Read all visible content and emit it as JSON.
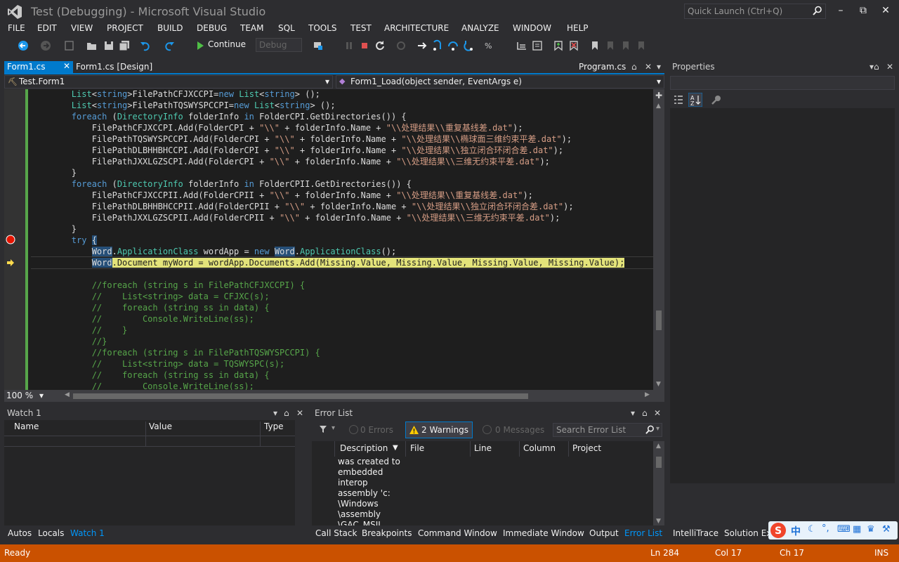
{
  "window": {
    "title": "Test (Debugging) - Microsoft Visual Studio",
    "quick_launch_placeholder": "Quick Launch (Ctrl+Q)"
  },
  "menu": [
    "FILE",
    "EDIT",
    "VIEW",
    "PROJECT",
    "BUILD",
    "DEBUG",
    "TEAM",
    "SQL",
    "TOOLS",
    "TEST",
    "ARCHITECTURE",
    "ANALYZE",
    "WINDOW",
    "HELP"
  ],
  "toolbar": {
    "continue_label": "Continue",
    "config_value": "Debug"
  },
  "doc_tabs": {
    "active": "Form1.cs",
    "design": "Form1.cs [Design]",
    "program": "Program.cs"
  },
  "nav": {
    "class_scope": "Test.Form1",
    "member_scope": "Form1_Load(object sender, EventArgs e)"
  },
  "editor": {
    "zoom": "100 %"
  },
  "code_lines": [
    "        List<string>FilePathCFJXCCPI=new List<string> ();",
    "        List<string>FilePathTQSWYSPCCPI=new List<string> ();",
    "        foreach (DirectoryInfo folderInfo in FolderCPI.GetDirectories()) {",
    "            FilePathCFJXCCPI.Add(FolderCPI + \"\\\\\" + folderInfo.Name + \"\\\\处理结果\\\\重复基线差.dat\");",
    "            FilePathTQSWYSPCCPI.Add(FolderCPI + \"\\\\\" + folderInfo.Name + \"\\\\处理结果\\\\椭球面三维约束平差.dat\");",
    "            FilePathDLBHHBHCCPI.Add(FolderCPI + \"\\\\\" + folderInfo.Name + \"\\\\处理结果\\\\独立闭合环闭合差.dat\");",
    "            FilePathJXXLGZSCPI.Add(FolderCPI + \"\\\\\" + folderInfo.Name + \"\\\\处理结果\\\\三维无约束平差.dat\");",
    "        }",
    "        foreach (DirectoryInfo folderInfo in FolderCPII.GetDirectories()) {",
    "            FilePathCFJXCCPII.Add(FolderCPII + \"\\\\\" + folderInfo.Name + \"\\\\处理结果\\\\重复基线差.dat\");",
    "            FilePathDLBHHBHCCPII.Add(FolderCPII + \"\\\\\" + folderInfo.Name + \"\\\\处理结果\\\\独立闭合环闭合差.dat\");",
    "            FilePathJXXLGZSCPII.Add(FolderCPII + \"\\\\\" + folderInfo.Name + \"\\\\处理结果\\\\三维无约束平差.dat\");",
    "        }",
    "        try {",
    "            Word.ApplicationClass wordApp = new Word.ApplicationClass();",
    "            Word.Document myWord = wordApp.Documents.Add(Missing.Value, Missing.Value, Missing.Value, Missing.Value);",
    "",
    "            //foreach (string s in FilePathCFJXCCPI) {",
    "            //    List<string> data = CFJXC(s);",
    "            //    foreach (string ss in data) {",
    "            //        Console.WriteLine(ss);",
    "            //    }",
    "            //}",
    "            //foreach (string s in FilePathTQSWYSPCCPI) {",
    "            //    List<string> data = TQSWYSPC(s);",
    "            //    foreach (string ss in data) {",
    "            //        Console.WriteLine(ss);"
  ],
  "properties": {
    "title": "Properties"
  },
  "watch": {
    "title": "Watch 1",
    "columns": [
      "Name",
      "Value",
      "Type"
    ]
  },
  "error_list": {
    "title": "Error List",
    "errors": "0 Errors",
    "warnings": "2 Warnings",
    "messages": "0 Messages",
    "search_placeholder": "Search Error List",
    "columns": [
      "Description",
      "File",
      "Line",
      "Column",
      "Project"
    ],
    "message_text": "was created to\nembedded\ninterop\nassembly 'c:\n\\Windows\n\\assembly\n\\GAC_MSIL"
  },
  "bottom_tabs_left": [
    "Autos",
    "Locals",
    "Watch 1"
  ],
  "bottom_tabs_mid": [
    "Call Stack",
    "Breakpoints",
    "Command Window",
    "Immediate Window",
    "Output",
    "Error List"
  ],
  "bottom_tabs_right": [
    "IntelliTrace",
    "Solution Exp"
  ],
  "status": {
    "ready": "Ready",
    "line": "Ln 284",
    "col": "Col 17",
    "ch": "Ch 17",
    "mode": "INS"
  },
  "ime": {
    "lang": "中"
  },
  "colors": {
    "accent": "#007acc",
    "status_debug": "#ca5100",
    "breakpoint": "#e51400"
  }
}
